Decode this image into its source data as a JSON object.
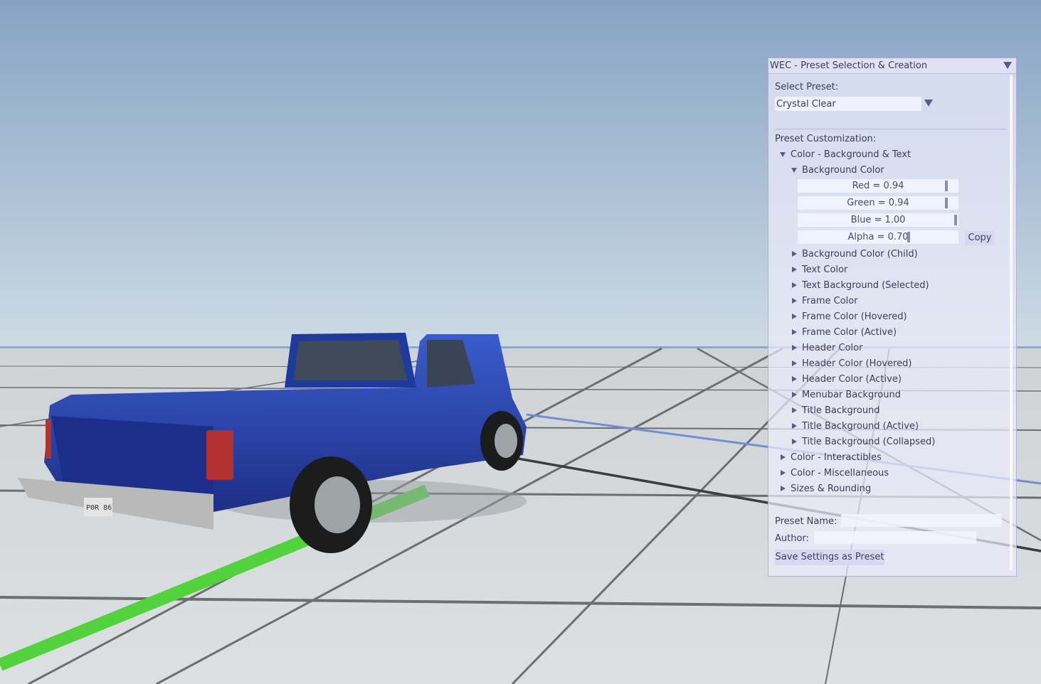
{
  "window": {
    "title": "WEC - Preset Selection & Creation"
  },
  "preset": {
    "select_label": "Select Preset:",
    "selected": "Crystal Clear"
  },
  "customization": {
    "heading": "Preset Customization:",
    "group_background_text": "Color - Background & Text",
    "background_color": {
      "label": "Background Color",
      "red": "Red = 0.94",
      "green": "Green = 0.94",
      "blue": "Blue = 1.00",
      "alpha": "Alpha = 0.70",
      "red_value": 0.94,
      "green_value": 0.94,
      "blue_value": 1.0,
      "alpha_value": 0.7,
      "copy_label": "Copy"
    },
    "items": [
      "Background Color (Child)",
      "Text Color",
      "Text Background (Selected)",
      "Frame Color",
      "Frame Color (Hovered)",
      "Frame Color (Active)",
      "Header Color",
      "Header Color (Hovered)",
      "Header Color (Active)",
      "Menubar Background",
      "Title Background",
      "Title Background (Active)",
      "Title Background (Collapsed)"
    ],
    "groups": [
      "Color - Interactibles",
      "Color - Miscellaneous",
      "Sizes & Rounding"
    ]
  },
  "form": {
    "preset_name_label": "Preset Name:",
    "preset_name_value": "",
    "author_label": "Author:",
    "author_value": "",
    "save_label": "Save Settings as Preset"
  },
  "scene": {
    "vehicle_color": "#2745b8",
    "ground_color": "#d9dbdc",
    "sky_top_color": "#87a3c4",
    "sky_bottom_color": "#c8d8e4",
    "highlight_line_color": "#52d23c",
    "plate_text": "P0R 86"
  }
}
